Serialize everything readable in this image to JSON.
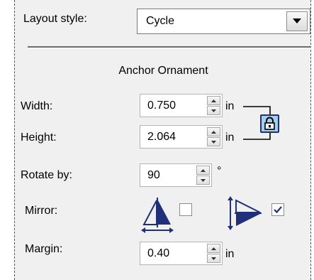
{
  "layout_style": {
    "label": "Layout style:",
    "value": "Cycle",
    "arrow_icon": "dropdown-arrow-icon"
  },
  "section": {
    "title": "Anchor Ornament"
  },
  "width": {
    "label": "Width:",
    "value": "0.750",
    "unit": "in"
  },
  "height": {
    "label": "Height:",
    "value": "2.064",
    "unit": "in"
  },
  "lock": {
    "icon": "lock-icon",
    "locked": true
  },
  "rotate": {
    "label": "Rotate by:",
    "value": "90",
    "unit": "°"
  },
  "mirror": {
    "label": "Mirror:",
    "horizontal": {
      "icon": "mirror-horizontal-icon",
      "checked": false
    },
    "vertical": {
      "icon": "mirror-vertical-icon",
      "checked": true
    }
  },
  "margin": {
    "label": "Margin:",
    "value": "0.40",
    "unit": "in"
  },
  "colors": {
    "panel": "#f0f0f0",
    "icon_blue": "#1f2f7a",
    "lock_bg": "#9fd0ec"
  }
}
